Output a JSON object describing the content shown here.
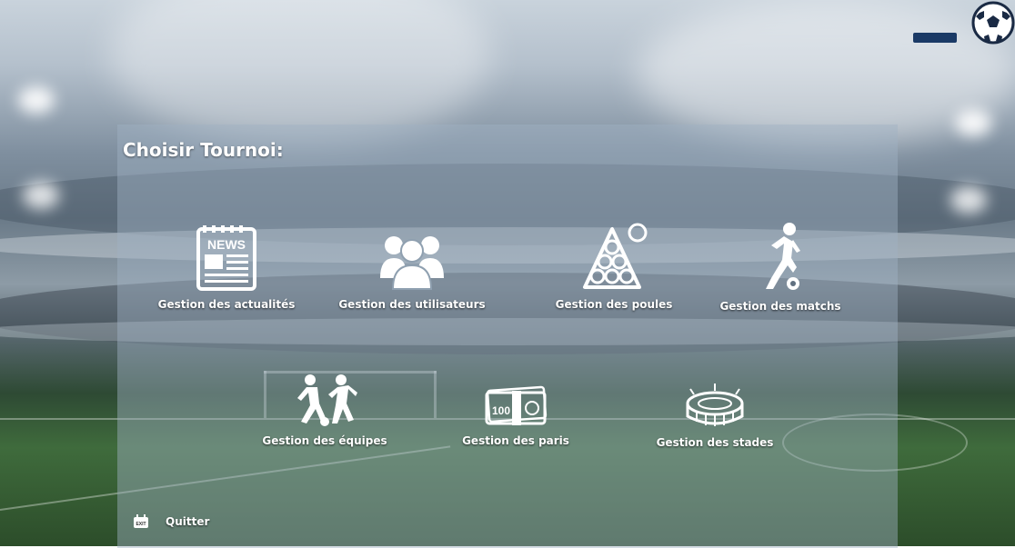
{
  "window": {
    "minimize_icon": "minimize-bar",
    "logo_icon": "soccer-ball-icon"
  },
  "panel": {
    "title": "Choisir Tournoi:"
  },
  "tiles": [
    {
      "label": "Gestion des actualités",
      "icon": "news-icon"
    },
    {
      "label": "Gestion des utilisateurs",
      "icon": "users-icon"
    },
    {
      "label": "Gestion des poules",
      "icon": "pool-balls-icon"
    },
    {
      "label": "Gestion des matchs",
      "icon": "player-kicking-icon"
    },
    {
      "label": "Gestion des équipes",
      "icon": "team-players-icon"
    },
    {
      "label": "Gestion des paris",
      "icon": "money-bills-icon"
    },
    {
      "label": "Gestion des stades",
      "icon": "stadium-icon"
    }
  ],
  "footer": {
    "quit_label": "Quitter",
    "quit_icon": "exit-icon",
    "quit_icon_text": "EXIT"
  },
  "colors": {
    "accent": "#1a3a66",
    "text": "#ffffff"
  }
}
